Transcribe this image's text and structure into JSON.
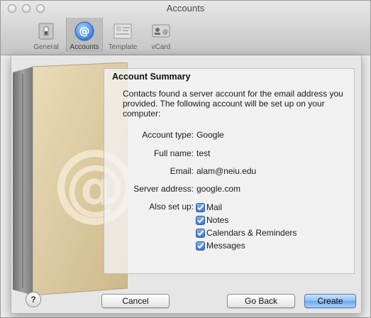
{
  "window": {
    "title": "Accounts"
  },
  "toolbar": {
    "items": [
      {
        "label": "General",
        "icon": "general-switch-icon"
      },
      {
        "label": "Accounts",
        "icon": "at-sign-icon",
        "selected": true
      },
      {
        "label": "Template",
        "icon": "template-icon"
      },
      {
        "label": "vCard",
        "icon": "vcard-icon"
      }
    ]
  },
  "summary": {
    "heading": "Account Summary",
    "description": "Contacts found a server account for the email address you provided. The following account will be set up on your computer:",
    "fields": [
      {
        "label": "Account type:",
        "value": "Google"
      },
      {
        "label": "Full name:",
        "value": "test"
      },
      {
        "label": "Email:",
        "value": "alam@neiu.edu"
      },
      {
        "label": "Server address:",
        "value": "google.com"
      }
    ],
    "also_set_up_label": "Also set up:",
    "services": [
      {
        "label": "Mail",
        "checked": true
      },
      {
        "label": "Notes",
        "checked": true
      },
      {
        "label": "Calendars & Reminders",
        "checked": true
      },
      {
        "label": "Messages",
        "checked": true
      }
    ]
  },
  "buttons": {
    "help": "?",
    "cancel": "Cancel",
    "go_back": "Go Back",
    "create": "Create"
  },
  "colors": {
    "accent": "#3a78cf",
    "book_cover": "#d8c49a",
    "book_spine": "#8a8a8a"
  }
}
